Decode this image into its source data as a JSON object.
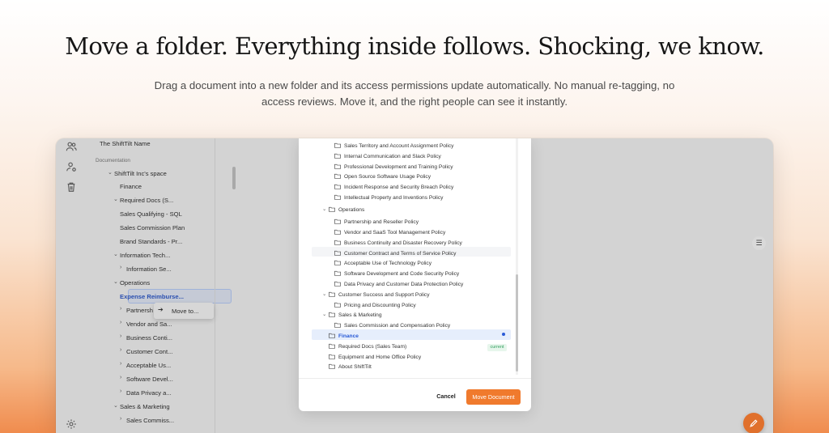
{
  "hero": {
    "headline": "Move a folder. Everything inside follows. Shocking, we know.",
    "subline": "Drag a document into a new folder and its access permissions update automatically. No manual re-tagging, no access reviews. Move it, and the right people can see it instantly."
  },
  "rail": {
    "icons": [
      "users-icon",
      "user-settings-icon",
      "trash-icon",
      "settings-icon"
    ]
  },
  "sidebar": {
    "workspace_name": "The ShiftTilt Name",
    "section_label": "Documentation",
    "space_name": "ShiftTilt Inc's space",
    "items": [
      "Finance",
      "Required Docs (S...",
      "Sales Qualifying - SQL",
      "Sales Commission Plan",
      "Brand Standards - Pr...",
      "Information Tech...",
      "Information Se...",
      "Operations",
      "Expense Reimburse...",
      "Partnersh",
      "Vendor and Sa...",
      "Business Conti...",
      "Customer Cont...",
      "Acceptable Us...",
      "Software Devel...",
      "Data Privacy a...",
      "Sales & Marketing",
      "Sales Commiss..."
    ]
  },
  "context_menu": {
    "label": "Move to..."
  },
  "modal": {
    "tree": [
      "Sales Territory and Account Assignment Policy",
      "Internal Communication and Slack Policy",
      "Professional Development and Training Policy",
      "Open Source Software Usage Policy",
      "Incident Response and Security Breach Policy",
      "Intellectual Property and Inventions Policy",
      "Operations",
      "Partnership and Reseller Policy",
      "Vendor and SaaS Tool Management Policy",
      "Business Continuity and Disaster Recovery Policy",
      "Customer Contract and Terms of Service Policy",
      "Acceptable Use of Technology Policy",
      "Software Development and Code Security Policy",
      "Data Privacy and Customer Data Protection Policy",
      "Customer Success and Support Policy",
      "Pricing and Discounting Policy",
      "Sales & Marketing",
      "Sales Commission and Compensation Policy",
      "Finance",
      "Required Docs (Sales Team)",
      "Equipment and Home Office Policy",
      "About ShiftTilt"
    ],
    "current_badge": "current",
    "cancel_label": "Cancel",
    "move_label": "Move Document"
  },
  "colors": {
    "accent": "#f07a2d",
    "selection_blue": "#2a5bd7",
    "current_green": "#2e9e5b"
  }
}
